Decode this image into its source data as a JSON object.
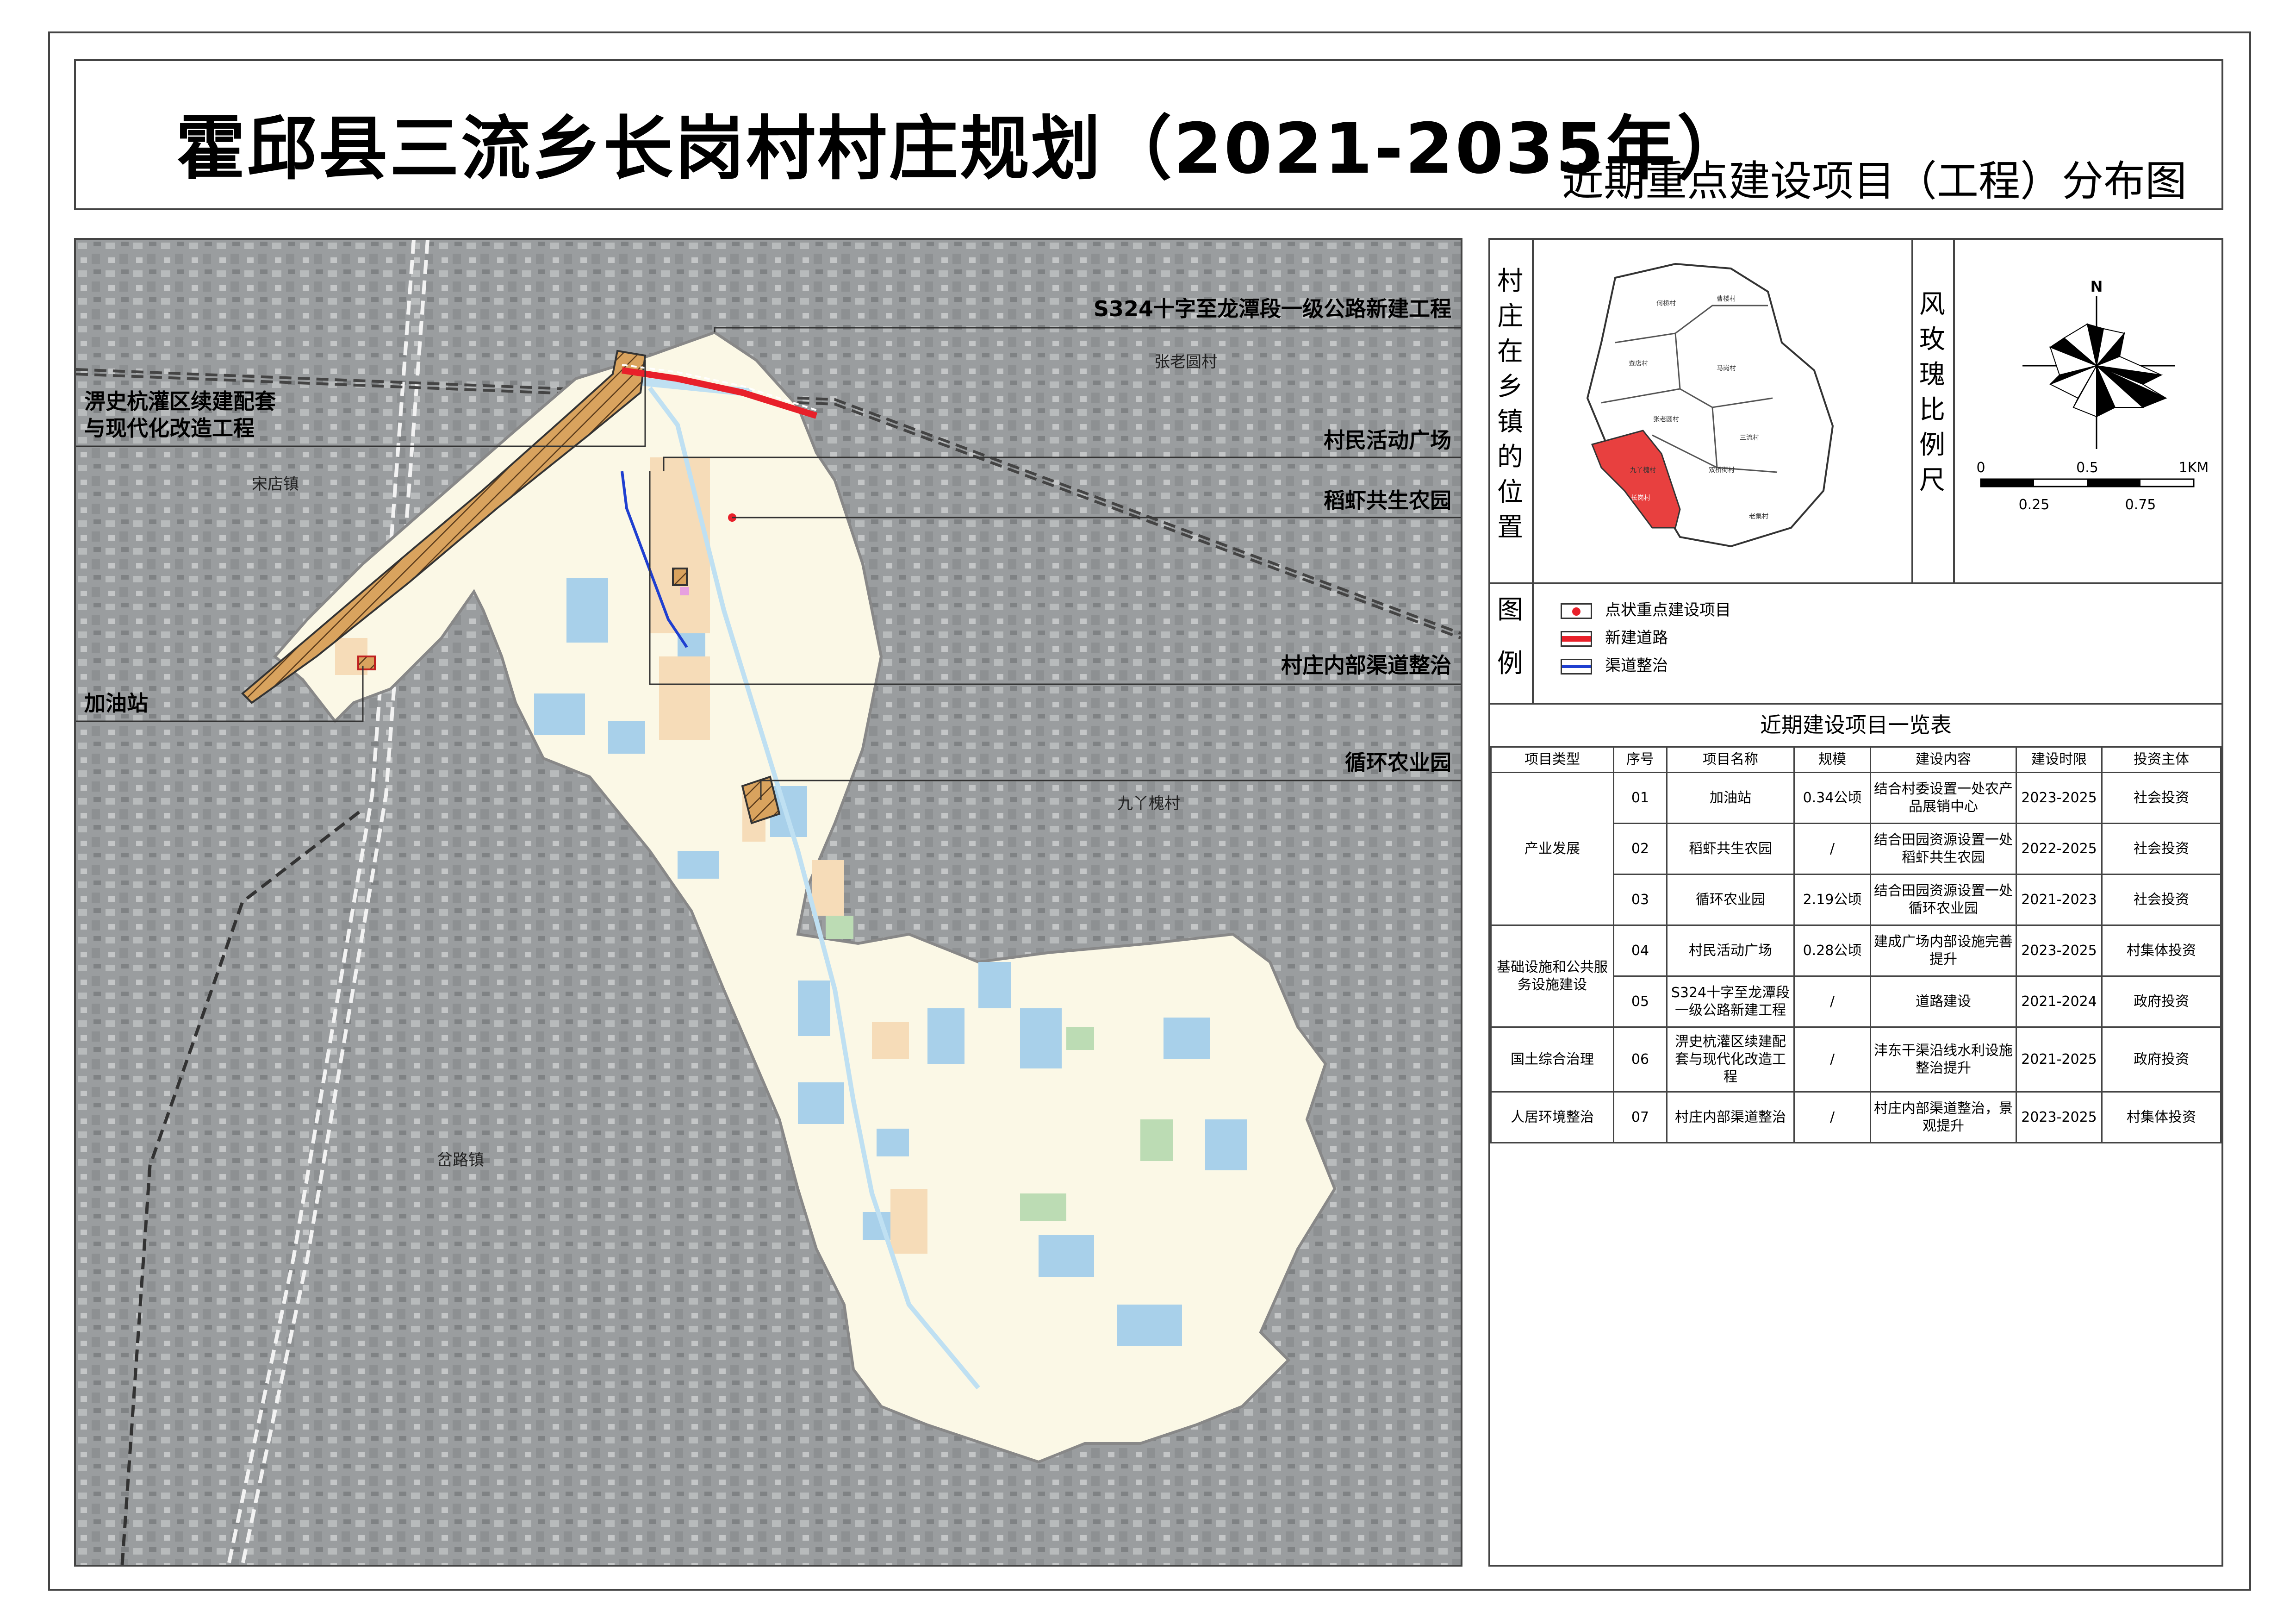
{
  "title": "霍邱县三流乡长岗村村庄规划（2021-2035年）",
  "subtitle": "近期重点建设项目（工程）分布图",
  "callouts": {
    "road_project": "S324十字至龙潭段一级公路新建工程",
    "canal_project_line1": "淠史杭灌区续建配套",
    "canal_project_line2": "与现代化改造工程",
    "plaza": "村民活动广场",
    "rice_shrimp": "稻虾共生农园",
    "internal_canal": "村庄内部渠道整治",
    "gas_station": "加油站",
    "circular_farm": "循环农业园"
  },
  "place_names": {
    "zhanglaoyuan": "张老圆村",
    "songdian": "宋店镇",
    "jiuyahuai": "九丫槐村",
    "chalu": "岔路镇"
  },
  "location_panel": {
    "heading": "村庄在乡镇的位置",
    "heading_chars": [
      "村",
      "庄",
      "在",
      "乡",
      "镇",
      "的",
      "位",
      "置"
    ],
    "highlight_color": "#e8403f",
    "village_labels": [
      "何桥村",
      "曹楼村",
      "查店村",
      "马岗村",
      "长岗村",
      "三流村",
      "九丫槐村",
      "双桥街村",
      "张老圆村",
      "老集村"
    ]
  },
  "compass_panel": {
    "heading_chars": [
      "风",
      "玫",
      "瑰",
      "比",
      "例",
      "尺"
    ],
    "north_label": "N",
    "scale_top_labels": [
      "0",
      "0.5",
      "1KM"
    ],
    "scale_bottom_labels": [
      "0.25",
      "0.75"
    ]
  },
  "legend": {
    "heading_chars": [
      "图",
      "例"
    ],
    "items": [
      {
        "label": "点状重点建设项目",
        "symbol": "red-dot",
        "color": "#e8202a"
      },
      {
        "label": "新建道路",
        "symbol": "red-line",
        "color": "#e8202a"
      },
      {
        "label": "渠道整治",
        "symbol": "blue-line",
        "color": "#1f3fd0"
      }
    ]
  },
  "project_table": {
    "title": "近期建设项目一览表",
    "headers": [
      "项目类型",
      "序号",
      "项目名称",
      "规模",
      "建设内容",
      "建设时限",
      "投资主体"
    ],
    "groups": [
      {
        "type": "产业发展",
        "rows": [
          {
            "no": "01",
            "name": "加油站",
            "scale": "0.34公顷",
            "content": "结合村委设置一处农产品展销中心",
            "period": "2023-2025",
            "investor": "社会投资"
          },
          {
            "no": "02",
            "name": "稻虾共生农园",
            "scale": "/",
            "content": "结合田园资源设置一处稻虾共生农园",
            "period": "2022-2025",
            "investor": "社会投资"
          },
          {
            "no": "03",
            "name": "循环农业园",
            "scale": "2.19公顷",
            "content": "结合田园资源设置一处循环农业园",
            "period": "2021-2023",
            "investor": "社会投资"
          }
        ]
      },
      {
        "type": "基础设施和公共服务设施建设",
        "rows": [
          {
            "no": "04",
            "name": "村民活动广场",
            "scale": "0.28公顷",
            "content": "建成广场内部设施完善提升",
            "period": "2023-2025",
            "investor": "村集体投资"
          },
          {
            "no": "05",
            "name": "S324十字至龙潭段一级公路新建工程",
            "scale": "/",
            "content": "道路建设",
            "period": "2021-2024",
            "investor": "政府投资"
          }
        ]
      },
      {
        "type": "国土综合治理",
        "rows": [
          {
            "no": "06",
            "name": "淠史杭灌区续建配套与现代化改造工程",
            "scale": "/",
            "content": "沣东干渠沿线水利设施整治提升",
            "period": "2021-2025",
            "investor": "政府投资"
          }
        ]
      },
      {
        "type": "人居环境整治",
        "rows": [
          {
            "no": "07",
            "name": "村庄内部渠道整治",
            "scale": "/",
            "content": "村庄内部渠道整治，景观提升",
            "period": "2023-2025",
            "investor": "村集体投资"
          }
        ]
      }
    ]
  },
  "colors": {
    "village_fill": "#fbf8e6",
    "surroundings": "#a9acae",
    "water": "#a8d0ea",
    "new_road": "#e8202a",
    "canal_project_fill": "#d9a35e",
    "channel": "#1f3fd0"
  }
}
